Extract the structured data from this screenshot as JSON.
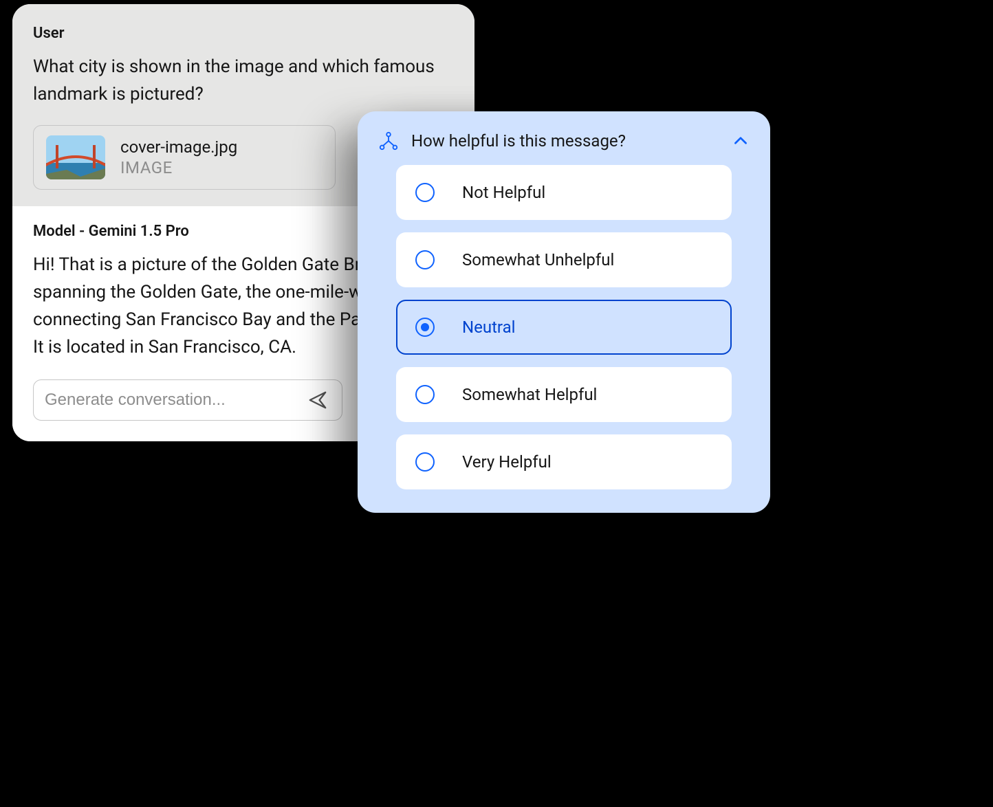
{
  "chat": {
    "user_label": "User",
    "user_text": "What city is shown in the image and which famous landmark is pictured?",
    "attachment": {
      "name": "cover-image.jpg",
      "type_label": "IMAGE"
    },
    "model_label": "Model - Gemini 1.5 Pro",
    "model_text": "Hi! That is a picture of the Golden Gate Bridge spanning the Golden Gate, the one-mile-wide strait connecting San Francisco Bay and the Pacific Ocean. It is located in San Francisco, CA.",
    "input_placeholder": "Generate conversation..."
  },
  "help": {
    "title": "How helpful is this message?",
    "options": [
      {
        "label": "Not Helpful"
      },
      {
        "label": "Somewhat Unhelpful"
      },
      {
        "label": "Neutral"
      },
      {
        "label": "Somewhat Helpful"
      },
      {
        "label": "Very Helpful"
      }
    ],
    "selected_index": 2
  },
  "colors": {
    "accent": "#0f62fe",
    "panel": "#d0e2ff"
  }
}
